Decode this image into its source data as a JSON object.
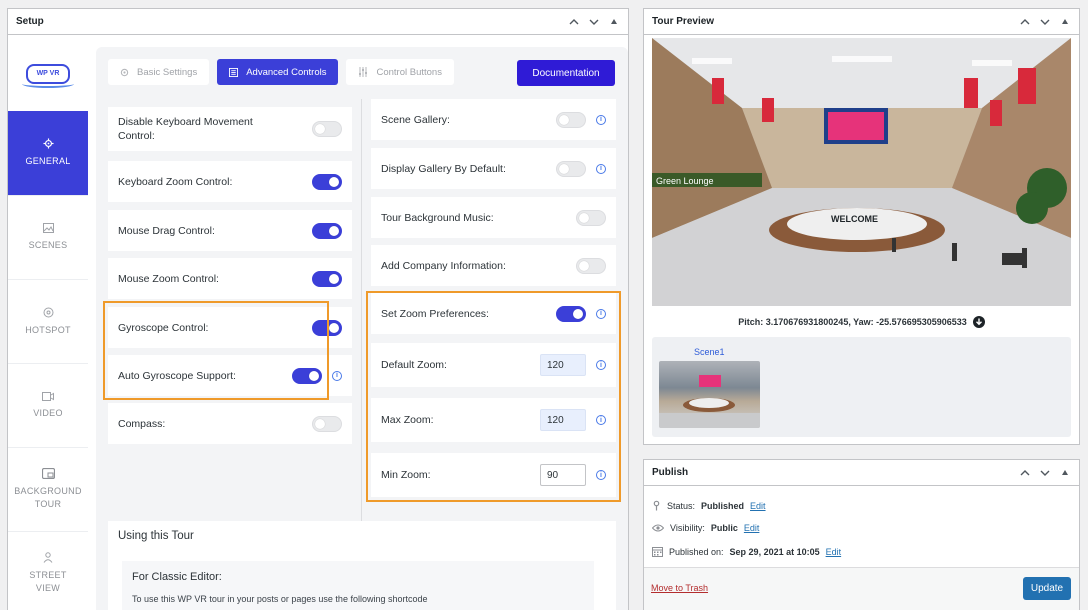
{
  "setup": {
    "title": "Setup",
    "logo_text": "WP VR",
    "nav": [
      {
        "label": "GENERAL",
        "icon": "gear-icon"
      },
      {
        "label": "SCENES",
        "icon": "image-icon"
      },
      {
        "label": "HOTSPOT",
        "icon": "crosshair-icon"
      },
      {
        "label": "VIDEO",
        "icon": "video-icon"
      },
      {
        "label": "BACKGROUND TOUR",
        "icon": "picture-in-picture-icon"
      },
      {
        "label": "STREET VIEW",
        "icon": "person-icon"
      }
    ],
    "tabs": [
      {
        "label": "Basic Settings",
        "active": false
      },
      {
        "label": "Advanced Controls",
        "active": true
      },
      {
        "label": "Control Buttons",
        "active": false
      }
    ],
    "doc_button": "Documentation",
    "left_controls": [
      {
        "label": "Disable Keyboard Movement Control:",
        "on": false
      },
      {
        "label": "Keyboard Zoom Control:",
        "on": true
      },
      {
        "label": "Mouse Drag Control:",
        "on": true
      },
      {
        "label": "Mouse Zoom Control:",
        "on": true
      },
      {
        "label": "Gyroscope Control:",
        "on": true
      },
      {
        "label": "Auto Gyroscope Support:",
        "on": true
      },
      {
        "label": "Compass:",
        "on": false
      }
    ],
    "right_controls": [
      {
        "label": "Scene Gallery:",
        "on": false
      },
      {
        "label": "Display Gallery By Default:",
        "on": false
      },
      {
        "label": "Tour Background Music:",
        "on": false
      },
      {
        "label": "Add Company Information:",
        "on": false
      },
      {
        "label": "Set Zoom Preferences:",
        "on": true
      }
    ],
    "zoom": [
      {
        "label": "Default Zoom:",
        "value": "120"
      },
      {
        "label": "Max Zoom:",
        "value": "120"
      },
      {
        "label": "Min Zoom:",
        "value": "90"
      }
    ],
    "using": {
      "title": "Using this Tour",
      "classic_heading": "For Classic Editor:",
      "classic_text": "To use this WP VR tour in your posts or pages use the following shortcode"
    }
  },
  "preview": {
    "title": "Tour Preview",
    "banner_text": "WELCOME",
    "sign_text": "Green Lounge",
    "pitch_yaw": "Pitch: 3.170676931800245, Yaw: -25.576695305906533",
    "scene_label": "Scene1"
  },
  "publish": {
    "title": "Publish",
    "status_label": "Status:",
    "status_value": "Published",
    "visibility_label": "Visibility:",
    "visibility_value": "Public",
    "published_label": "Published on:",
    "published_value": "Sep 29, 2021 at 10:05",
    "edit": "Edit",
    "trash": "Move to Trash",
    "update": "Update"
  },
  "colors": {
    "accent": "#3b3fd8",
    "highlight": "#ef9a2a",
    "wp_blue": "#2271b1"
  }
}
